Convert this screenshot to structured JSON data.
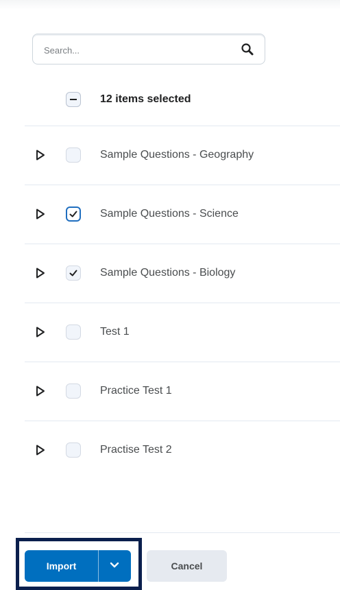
{
  "search": {
    "placeholder": "Search...",
    "value": ""
  },
  "selection": {
    "label": "12 items selected",
    "state": "indeterminate"
  },
  "items": [
    {
      "label": "Sample Questions - Geography",
      "checked": false
    },
    {
      "label": "Sample Questions - Science",
      "checked": true
    },
    {
      "label": "Sample Questions - Biology",
      "checked": true
    },
    {
      "label": "Test 1",
      "checked": false
    },
    {
      "label": "Practice Test 1",
      "checked": false
    },
    {
      "label": "Practise Test 2",
      "checked": false
    }
  ],
  "footer": {
    "import_label": "Import",
    "cancel_label": "Cancel"
  },
  "icons": {
    "search": "search-icon",
    "expand": "caret-right-icon",
    "menu": "chevron-down-icon",
    "check": "checkmark-icon"
  },
  "colors": {
    "primary": "#006fbf",
    "focus_frame": "#0b1f4d",
    "checkbox_bg": "#f1f5fb"
  }
}
